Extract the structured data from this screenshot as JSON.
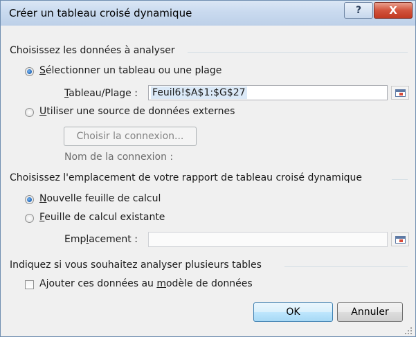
{
  "window": {
    "title": "Créer un tableau croisé dynamique",
    "help_label": "?",
    "close_label": "X"
  },
  "section1": {
    "heading": "Choisissez les données à analyser",
    "radio_table": {
      "label_u": "S",
      "label_rest": "électionner un tableau ou une plage",
      "selected": true
    },
    "range": {
      "label_u": "T",
      "label_rest": "ableau/Plage :",
      "value": "Feuil6!$A$1:$G$27"
    },
    "radio_external": {
      "label_u": "U",
      "label_rest": "tiliser une source de données externes",
      "selected": false
    },
    "choose_connection_label": "Choisir la connexion...",
    "connection_name_label": "Nom de la connexion :"
  },
  "section2": {
    "heading": "Choisissez l'emplacement de votre rapport de tableau croisé dynamique",
    "radio_new": {
      "label_u": "N",
      "label_rest": "ouvelle feuille de calcul",
      "selected": true
    },
    "radio_existing": {
      "label_u": "F",
      "label_rest": "euille de calcul existante",
      "selected": false
    },
    "location": {
      "label_pre": "Emp",
      "label_u": "l",
      "label_rest": "acement :",
      "value": ""
    }
  },
  "section3": {
    "heading": "Indiquez si vous souhaitez analyser plusieurs tables",
    "checkbox": {
      "label_pre": "Ajouter ces données au ",
      "label_u": "m",
      "label_rest": "odèle de données",
      "checked": false
    }
  },
  "buttons": {
    "ok": "OK",
    "cancel": "Annuler"
  }
}
